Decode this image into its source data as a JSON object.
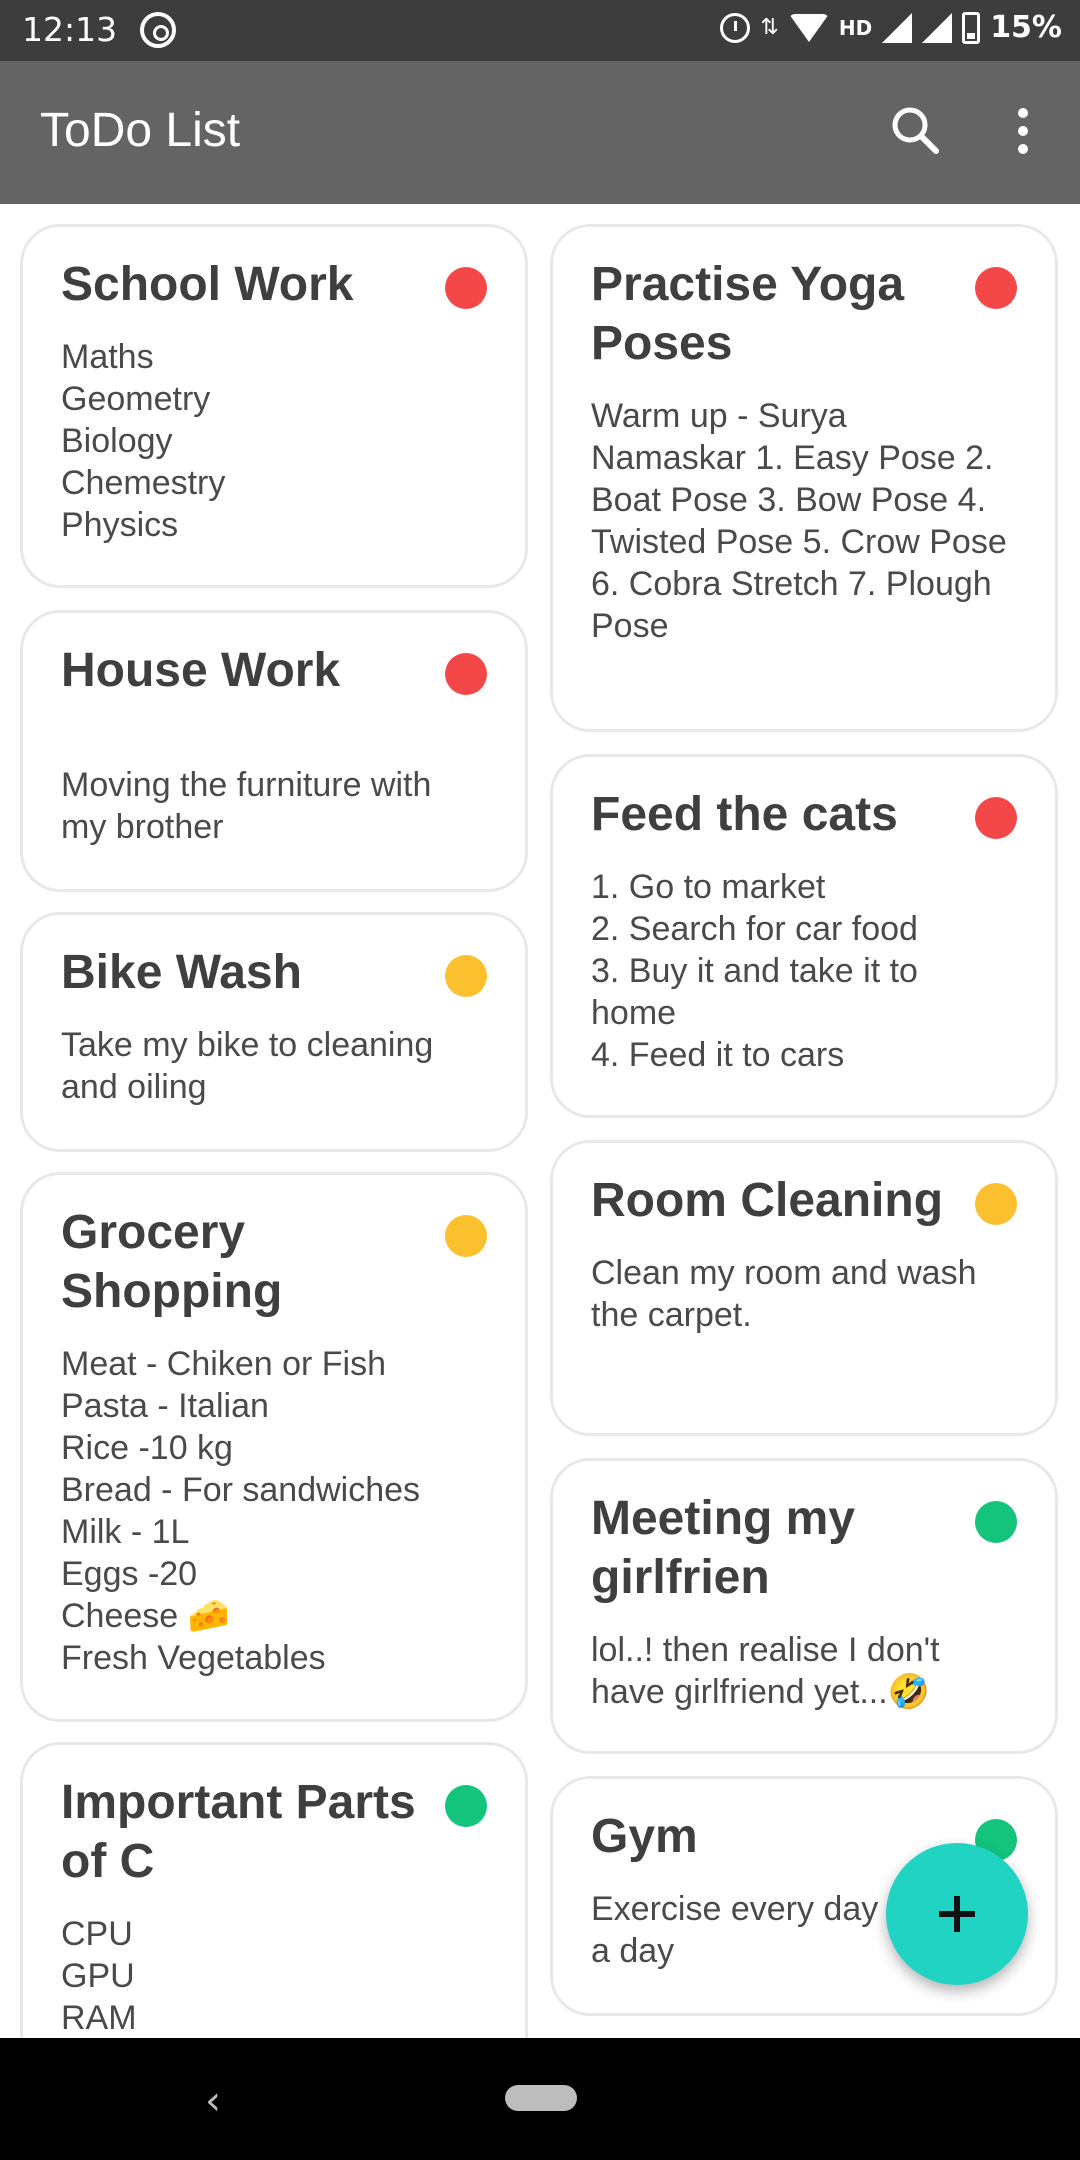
{
  "status_bar": {
    "time": "12:13",
    "network": "HD",
    "battery": "15%"
  },
  "app_bar": {
    "title": "ToDo List",
    "icons": [
      "search-icon",
      "more-vert-icon"
    ]
  },
  "colors": {
    "app_bar": "#646464",
    "status_bar": "#3d3d3d",
    "priority_high": "#f44747",
    "priority_medium": "#fbc02d",
    "priority_low": "#14c47d",
    "fab": "#20d3c2"
  },
  "notes_left": [
    {
      "title": "School Work",
      "body": "Maths\nGeometry\nBiology\nChemestry\nPhysics",
      "priority": "high"
    },
    {
      "title": "House Work",
      "body": "\nMoving the furniture with my brother",
      "priority": "high"
    },
    {
      "title": "Bike Wash",
      "body": "Take my bike to cleaning and oiling",
      "priority": "medium"
    },
    {
      "title": "Grocery Shopping",
      "body": "Meat - Chiken or Fish\nPasta - Italian\nRice -10 kg\nBread - For sandwiches\nMilk - 1L\nEggs -20\nCheese 🧀\nFresh Vegetables",
      "priority": "medium"
    },
    {
      "title": "Important Parts of C",
      "body": "CPU\nGPU\nRAM",
      "priority": "low"
    }
  ],
  "notes_right": [
    {
      "title": "Practise Yoga Poses",
      "body": "Warm up - Surya Namaskar 1. Easy Pose 2. Boat Pose 3. Bow Pose 4. Twisted Pose 5. Crow Pose 6. Cobra Stretch 7. Plough Pose",
      "priority": "high"
    },
    {
      "title": "Feed the cats",
      "body": "1. Go to market\n2. Search for car food\n3. Buy it and take it to home\n4. Feed it to cars",
      "priority": "high"
    },
    {
      "title": "Room Cleaning",
      "body": "Clean my room and wash the carpet.",
      "priority": "medium"
    },
    {
      "title": "Meeting my girlfrien",
      "body": "lol..! then realise I don't have girlfriend yet...🤣",
      "priority": "low"
    },
    {
      "title": "Gym",
      "body": "Exercise every day 30 mins a day",
      "priority": "low"
    }
  ],
  "fab": {
    "icon": "plus-icon"
  },
  "nav_bar": {
    "back": "‹"
  }
}
